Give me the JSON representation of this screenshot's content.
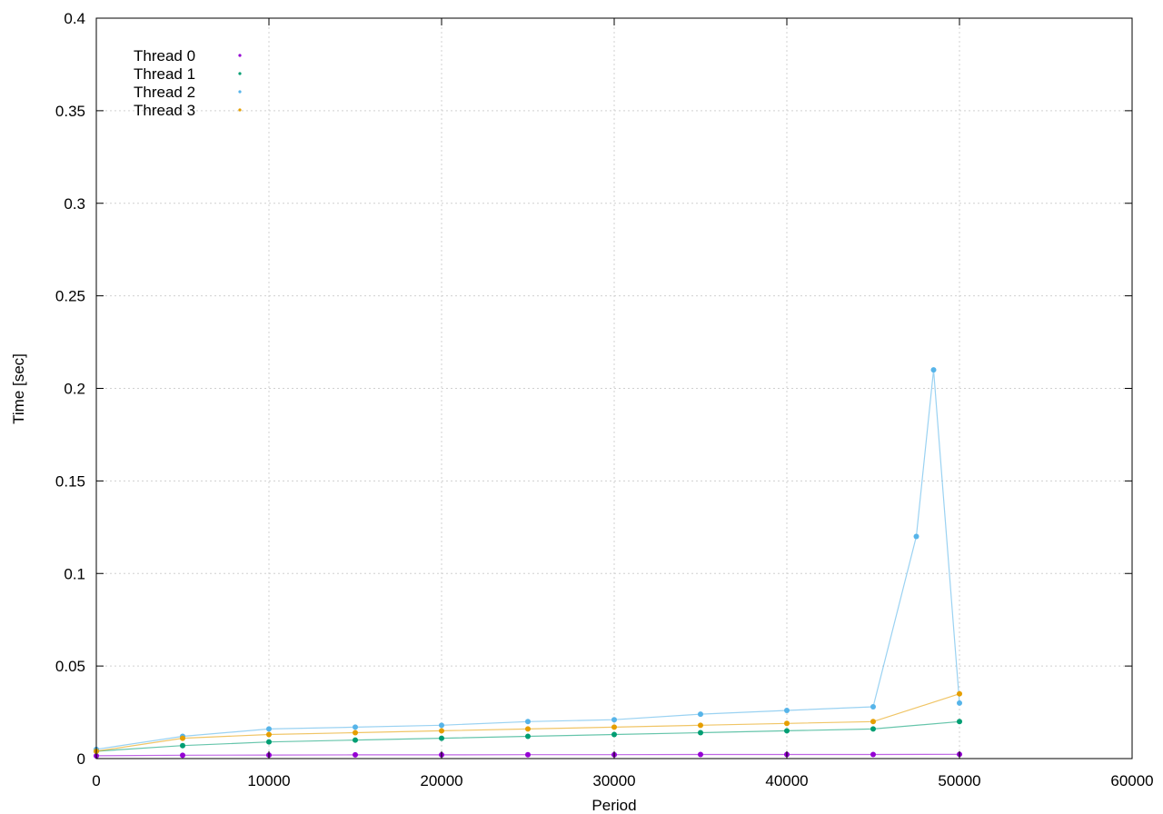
{
  "chart_data": {
    "type": "scatter",
    "title": "",
    "xlabel": "Period",
    "ylabel": "Time [sec]",
    "xlim": [
      0,
      60000
    ],
    "ylim": [
      0,
      0.4
    ],
    "xticks": [
      0,
      10000,
      20000,
      30000,
      40000,
      50000,
      60000
    ],
    "xtick_labels": [
      "0",
      "10000",
      "20000",
      "30000",
      "40000",
      "50000",
      "60000"
    ],
    "yticks": [
      0,
      0.05,
      0.1,
      0.15,
      0.2,
      0.25,
      0.3,
      0.35,
      0.4
    ],
    "ytick_labels": [
      "0",
      "0.05",
      "0.1",
      "0.15",
      "0.2",
      "0.25",
      "0.3",
      "0.35",
      "0.4"
    ],
    "grid": true,
    "legend_position": "top-left",
    "series": [
      {
        "name": "Thread 0",
        "color": "#9400d3",
        "x": [
          0,
          5000,
          10000,
          15000,
          20000,
          25000,
          30000,
          35000,
          40000,
          45000,
          50000
        ],
        "y": [
          0.0015,
          0.0018,
          0.0019,
          0.002,
          0.002,
          0.0021,
          0.0021,
          0.0022,
          0.0022,
          0.0022,
          0.0023
        ]
      },
      {
        "name": "Thread 1",
        "color": "#009e73",
        "x": [
          0,
          5000,
          10000,
          15000,
          20000,
          25000,
          30000,
          35000,
          40000,
          45000,
          50000
        ],
        "y": [
          0.004,
          0.007,
          0.009,
          0.01,
          0.011,
          0.012,
          0.013,
          0.014,
          0.015,
          0.016,
          0.02
        ]
      },
      {
        "name": "Thread 2",
        "color": "#56b4e9",
        "x": [
          0,
          5000,
          10000,
          15000,
          20000,
          25000,
          30000,
          35000,
          40000,
          45000,
          47500,
          48500,
          50000
        ],
        "y": [
          0.005,
          0.012,
          0.016,
          0.017,
          0.018,
          0.02,
          0.021,
          0.024,
          0.026,
          0.028,
          0.12,
          0.21,
          0.03
        ]
      },
      {
        "name": "Thread 3",
        "color": "#e69f00",
        "x": [
          0,
          5000,
          10000,
          15000,
          20000,
          25000,
          30000,
          35000,
          40000,
          45000,
          50000
        ],
        "y": [
          0.004,
          0.011,
          0.013,
          0.014,
          0.015,
          0.016,
          0.017,
          0.018,
          0.019,
          0.02,
          0.035
        ]
      }
    ]
  }
}
